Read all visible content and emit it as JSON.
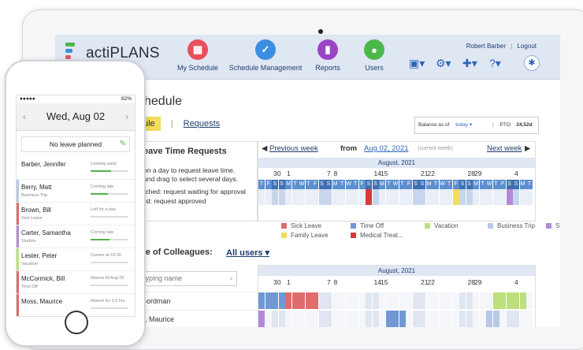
{
  "app": {
    "name": "actiPLANS"
  },
  "nav": [
    {
      "label": "My Schedule",
      "icon": "calendar-icon",
      "color": "#e8505b"
    },
    {
      "label": "Schedule Management",
      "icon": "check-shield-icon",
      "color": "#3b8ee0"
    },
    {
      "label": "Reports",
      "icon": "bar-chart-icon",
      "color": "#9b45c6"
    },
    {
      "label": "Users",
      "icon": "user-icon",
      "color": "#4bb84a"
    }
  ],
  "user": {
    "name": "Robert Barber",
    "sep": "|",
    "logout": "Logout"
  },
  "page": {
    "title": "chedule"
  },
  "tabs": {
    "active": "ule",
    "sep": "|",
    "requests": "Requests"
  },
  "balance": {
    "label": "Balance as of",
    "date": "today ▾",
    "pto_label": "PTO:",
    "pto_value": "24,52d"
  },
  "left_panel": {
    "title": "eave Time Requests",
    "lines": [
      "on a day to request leave time.",
      "and drag to select several days.",
      "tched: request waiting for approval",
      "lid: request approved"
    ]
  },
  "calendar": {
    "prev": "Previous week",
    "from": "from",
    "date": "Aug 02, 2021",
    "current": "(current week)",
    "next": "Next week",
    "month": "August, 2021",
    "day_numbers": [
      "30",
      "1",
      "7",
      "8",
      "14",
      "15",
      "21",
      "22",
      "28",
      "29",
      "4"
    ],
    "weekdays": [
      "T",
      "F",
      "S",
      "S",
      "M",
      "T",
      "W",
      "T",
      "F",
      "S",
      "S",
      "M",
      "T",
      "W",
      "T",
      "F",
      "S",
      "S",
      "M",
      "T",
      "W",
      "T",
      "F",
      "S",
      "S",
      "M",
      "T",
      "W",
      "T",
      "F",
      "S",
      "S",
      "M",
      "T",
      "W",
      "T",
      "F",
      "S",
      "S",
      "M",
      "T"
    ]
  },
  "legend": [
    {
      "label": "Sick Leave",
      "color": "#e06b6b"
    },
    {
      "label": "Time Off",
      "color": "#6f98d4"
    },
    {
      "label": "Vacation",
      "color": "#bde07a"
    },
    {
      "label": "Business Trip",
      "color": "#b8c9e6"
    },
    {
      "label": "Studies",
      "color": "#b48ad8"
    },
    {
      "label": "Family Leave",
      "color": "#f2dc5b"
    },
    {
      "label": "Medical Treat...",
      "color": "#d63a3a"
    }
  ],
  "colleagues": {
    "title": "ule of Colleagues:",
    "filter": "All users",
    "search_placeholder": "typing name",
    "month": "August, 2021",
    "names": [
      "Gordman",
      "n, Maurice"
    ]
  },
  "phone": {
    "status_left": "●●●●● ",
    "status_right": "82%",
    "date": "Wed, Aug 02",
    "no_leave": "No leave planned",
    "rows": [
      {
        "name": "Barber, Jennifer",
        "sub": "",
        "status": "Leaving early",
        "color": "#ffffff",
        "fill": 0.55
      },
      {
        "name": "Berry, Matt",
        "sub": "Business Trip",
        "status": "Coming late",
        "color": "#b8c9e6",
        "fill": 0.45
      },
      {
        "name": "Brown, Bill",
        "sub": "Sick Leave",
        "status": "Left for a day",
        "color": "#e06b6b",
        "fill": 0.0
      },
      {
        "name": "Carter, Samantha",
        "sub": "Studies",
        "status": "Coming late",
        "color": "#b48ad8",
        "fill": 0.5
      },
      {
        "name": "Lester, Peter",
        "sub": "Vacation",
        "status": "Comes at 16:00",
        "color": "#bde07a",
        "fill": 0.0
      },
      {
        "name": "McCormick, Bill",
        "sub": "Time Off",
        "status": "Absent till Aug 05",
        "color": "#e06b6b",
        "fill": 0.0
      },
      {
        "name": "Moss, Maurice",
        "sub": "",
        "status": "Absent for 3.5 hrs",
        "color": "#e06b6b",
        "fill": 0.0
      }
    ]
  }
}
